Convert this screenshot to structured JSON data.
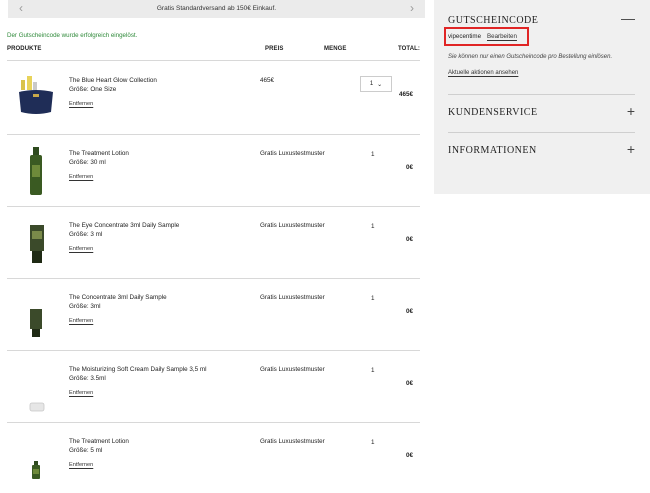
{
  "promo": {
    "text": "Gratis Standardversand ab 150€ Einkauf.",
    "prev_icon": "chevron-left-icon",
    "next_icon": "chevron-right-icon"
  },
  "success_message": "Der Gutscheincode wurde erfolgreich eingelöst.",
  "table": {
    "headers": {
      "product": "PRODUKTE",
      "price": "PREIS",
      "quantity": "MENGE",
      "total": "TOTAL:"
    }
  },
  "items": [
    {
      "name": "The Blue Heart Glow Collection",
      "size": "Größe: One Size",
      "remove": "Entfernen",
      "price": "465€",
      "qty": "1",
      "total": "465€",
      "qty_selector": true,
      "image": "blue-heart-collection"
    },
    {
      "name": "The Treatment Lotion",
      "size": "Größe: 30 ml",
      "remove": "Entfernen",
      "price": "Gratis Luxustestmuster",
      "qty": "1",
      "total": "0€",
      "qty_selector": false,
      "image": "treatment-lotion-bottle"
    },
    {
      "name": "The Eye Concentrate 3ml Daily Sample",
      "size": "Größe: 3 ml",
      "remove": "Entfernen",
      "price": "Gratis Luxustestmuster",
      "qty": "1",
      "total": "0€",
      "qty_selector": false,
      "image": "eye-concentrate-tube"
    },
    {
      "name": "The Concentrate 3ml Daily Sample",
      "size": "Größe: 3ml",
      "remove": "Entfernen",
      "price": "Gratis Luxustestmuster",
      "qty": "1",
      "total": "0€",
      "qty_selector": false,
      "image": "concentrate-tube"
    },
    {
      "name": "The Moisturizing Soft Cream Daily Sample 3,5 ml",
      "size": "Größe: 3.5ml",
      "remove": "Entfernen",
      "price": "Gratis Luxustestmuster",
      "qty": "1",
      "total": "0€",
      "qty_selector": false,
      "image": "soft-cream-jar"
    },
    {
      "name": "The Treatment Lotion",
      "size": "Größe: 5 ml",
      "remove": "Entfernen",
      "price": "Gratis Luxustestmuster",
      "qty": "1",
      "total": "0€",
      "qty_selector": false,
      "image": "treatment-lotion-small"
    }
  ],
  "sidebar": {
    "coupon": {
      "title": "GUTSCHEINCODE",
      "icon": "minus-icon",
      "code": "vipecentime",
      "edit": "Bearbeiten",
      "note": "Sie können nur einen Gutscheincode pro Bestellung einlösen.",
      "link": "Aktuelle aktionen ansehen"
    },
    "service": {
      "title": "KUNDENSERVICE",
      "icon": "plus-icon"
    },
    "info": {
      "title": "INFORMATIONEN",
      "icon": "plus-icon"
    }
  },
  "colors": {
    "success": "#2f8a3a",
    "highlight": "#e02525",
    "panel": "#f0f0f0"
  }
}
